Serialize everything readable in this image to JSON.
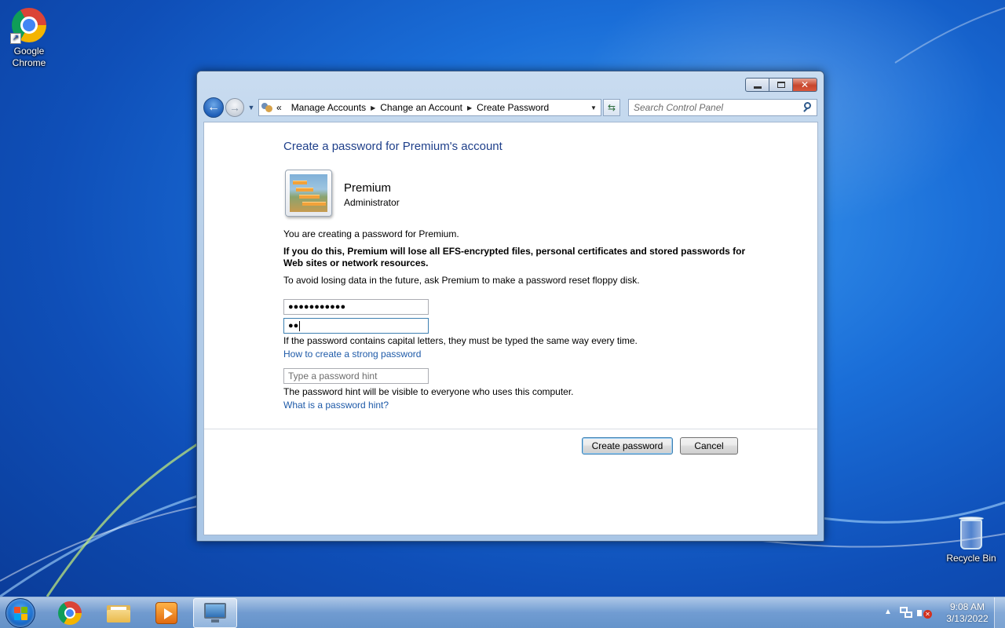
{
  "desktop": {
    "icons": [
      {
        "label": "Google\nChrome",
        "icon": "chrome-icon"
      },
      {
        "label": "Recycle Bin",
        "icon": "recycle-bin-icon"
      }
    ]
  },
  "window": {
    "icons": {
      "minimize": "minimize-icon",
      "maximize": "maximize-icon",
      "close": "close-icon"
    },
    "nav": {
      "back": "back-arrow-icon",
      "forward": "forward-arrow-icon",
      "breadcrumb_overflow": "«",
      "breadcrumbs": [
        "Manage Accounts",
        "Change an Account",
        "Create Password"
      ]
    },
    "search": {
      "placeholder": "Search Control Panel"
    }
  },
  "content": {
    "heading": "Create a password for Premium's account",
    "account": {
      "name": "Premium",
      "role": "Administrator"
    },
    "intro": "You are creating a password for Premium.",
    "warning": "If you do this, Premium will lose all EFS-encrypted files, personal certificates and stored passwords for Web sites or network resources.",
    "advice": "To avoid losing data in the future, ask Premium to make a password reset floppy disk.",
    "new_password": {
      "value": "●●●●●●●●●●●"
    },
    "confirm_password": {
      "value": "●●"
    },
    "caps_note": "If the password contains capital letters, they must be typed the same way every time.",
    "strong_link": "How to create a strong password",
    "hint": {
      "placeholder": "Type a password hint"
    },
    "hint_note": "The password hint will be visible to everyone who uses this computer.",
    "hint_link": "What is a password hint?",
    "buttons": {
      "create": "Create password",
      "cancel": "Cancel"
    }
  },
  "taskbar": {
    "items": [
      "start-button",
      "chrome-icon",
      "windows-explorer-icon",
      "media-player-icon",
      "control-panel-icon"
    ],
    "active_item": "control-panel-icon",
    "clock": {
      "time": "9:08 AM",
      "date": "3/13/2022"
    }
  },
  "colors": {
    "heading": "#1e3f8a",
    "link": "#1e5aa8",
    "desktop": "#1a6ed8"
  }
}
